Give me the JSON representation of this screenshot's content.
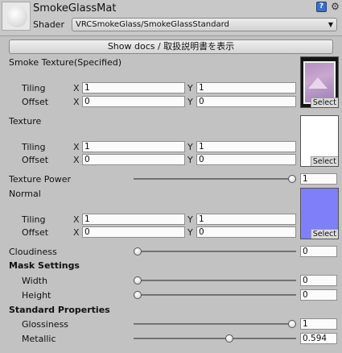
{
  "header": {
    "material_name": "SmokeGlassMat",
    "shader_label": "Shader",
    "shader_value": "VRCSmokeGlass/SmokeGlassStandard",
    "help_icon": "help-book-icon",
    "settings_icon": "gear-icon"
  },
  "docs_button": "Show docs / 取扱説明書を表示",
  "common": {
    "tiling": "Tiling",
    "offset": "Offset",
    "x": "X",
    "y": "Y",
    "select": "Select"
  },
  "smoke_texture": {
    "label": "Smoke Texture(Specified)",
    "tiling_x": "1",
    "tiling_y": "1",
    "offset_x": "0",
    "offset_y": "0"
  },
  "texture": {
    "label": "Texture",
    "tiling_x": "1",
    "tiling_y": "1",
    "offset_x": "0",
    "offset_y": "0"
  },
  "texture_power": {
    "label": "Texture Power",
    "value": "1",
    "fraction": 1.0
  },
  "normal": {
    "label": "Normal",
    "tiling_x": "1",
    "tiling_y": "1",
    "offset_x": "0",
    "offset_y": "0"
  },
  "cloudiness": {
    "label": "Cloudiness",
    "value": "0",
    "fraction": 0.0
  },
  "mask_settings": {
    "header": "Mask Settings",
    "width": {
      "label": "Width",
      "value": "0",
      "fraction": 0.0
    },
    "height": {
      "label": "Height",
      "value": "0",
      "fraction": 0.0
    }
  },
  "standard_properties": {
    "header": "Standard Properties",
    "glossiness": {
      "label": "Glossiness",
      "value": "1",
      "fraction": 1.0
    },
    "metallic": {
      "label": "Metallic",
      "value": "0.594",
      "fraction": 0.594
    }
  },
  "colors": {
    "panel_bg": "#c2c2c2",
    "normal_map_color": "#7f7ff9"
  }
}
